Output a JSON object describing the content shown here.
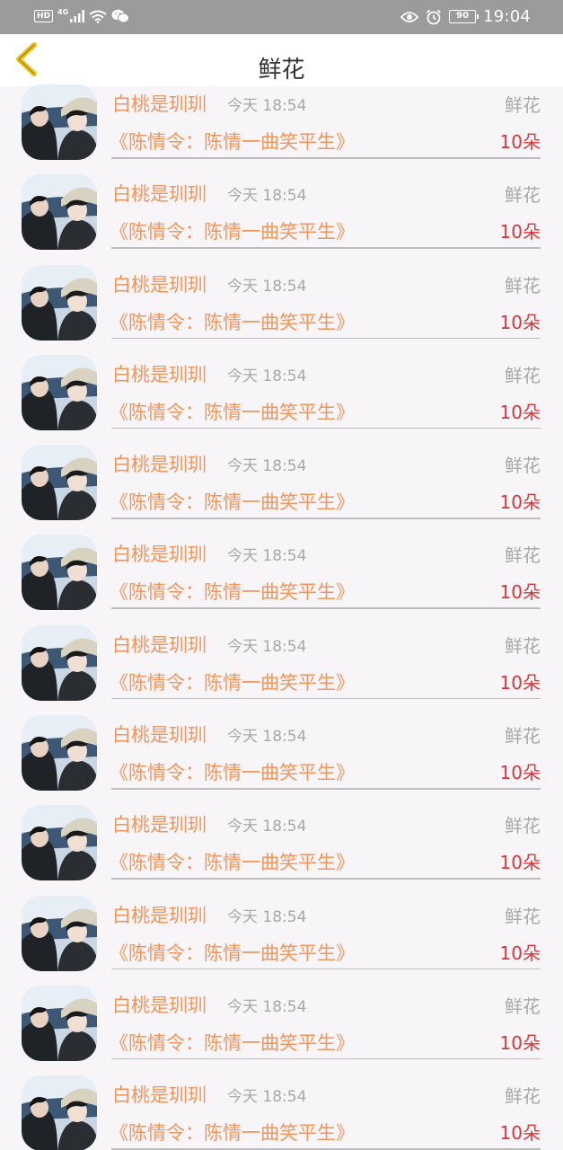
{
  "status_bar": {
    "hd": "HD",
    "network": "4G",
    "battery": "90",
    "time": "19:04"
  },
  "header": {
    "title": "鲜花"
  },
  "colors": {
    "accent": "#f0955b",
    "count": "#d8363a",
    "muted": "#a8a8a8",
    "back_arrow": "#e9c21b"
  },
  "icons": [
    "back-arrow-icon",
    "eye-icon",
    "alarm-icon",
    "wifi-icon",
    "signal-icon",
    "wechat-icon",
    "battery-icon"
  ],
  "records": [
    {
      "user": "白桃是玔玔",
      "time": "今天 18:54",
      "gift": "鲜花",
      "book": "《陈情令：陈情一曲笑平生》",
      "count": "10朵"
    },
    {
      "user": "白桃是玔玔",
      "time": "今天 18:54",
      "gift": "鲜花",
      "book": "《陈情令：陈情一曲笑平生》",
      "count": "10朵"
    },
    {
      "user": "白桃是玔玔",
      "time": "今天 18:54",
      "gift": "鲜花",
      "book": "《陈情令：陈情一曲笑平生》",
      "count": "10朵"
    },
    {
      "user": "白桃是玔玔",
      "time": "今天 18:54",
      "gift": "鲜花",
      "book": "《陈情令：陈情一曲笑平生》",
      "count": "10朵"
    },
    {
      "user": "白桃是玔玔",
      "time": "今天 18:54",
      "gift": "鲜花",
      "book": "《陈情令：陈情一曲笑平生》",
      "count": "10朵"
    },
    {
      "user": "白桃是玔玔",
      "time": "今天 18:54",
      "gift": "鲜花",
      "book": "《陈情令：陈情一曲笑平生》",
      "count": "10朵"
    },
    {
      "user": "白桃是玔玔",
      "time": "今天 18:54",
      "gift": "鲜花",
      "book": "《陈情令：陈情一曲笑平生》",
      "count": "10朵"
    },
    {
      "user": "白桃是玔玔",
      "time": "今天 18:54",
      "gift": "鲜花",
      "book": "《陈情令：陈情一曲笑平生》",
      "count": "10朵"
    },
    {
      "user": "白桃是玔玔",
      "time": "今天 18:54",
      "gift": "鲜花",
      "book": "《陈情令：陈情一曲笑平生》",
      "count": "10朵"
    },
    {
      "user": "白桃是玔玔",
      "time": "今天 18:54",
      "gift": "鲜花",
      "book": "《陈情令：陈情一曲笑平生》",
      "count": "10朵"
    },
    {
      "user": "白桃是玔玔",
      "time": "今天 18:54",
      "gift": "鲜花",
      "book": "《陈情令：陈情一曲笑平生》",
      "count": "10朵"
    },
    {
      "user": "白桃是玔玔",
      "time": "今天 18:54",
      "gift": "鲜花",
      "book": "《陈情令：陈情一曲笑平生》",
      "count": "10朵"
    }
  ]
}
